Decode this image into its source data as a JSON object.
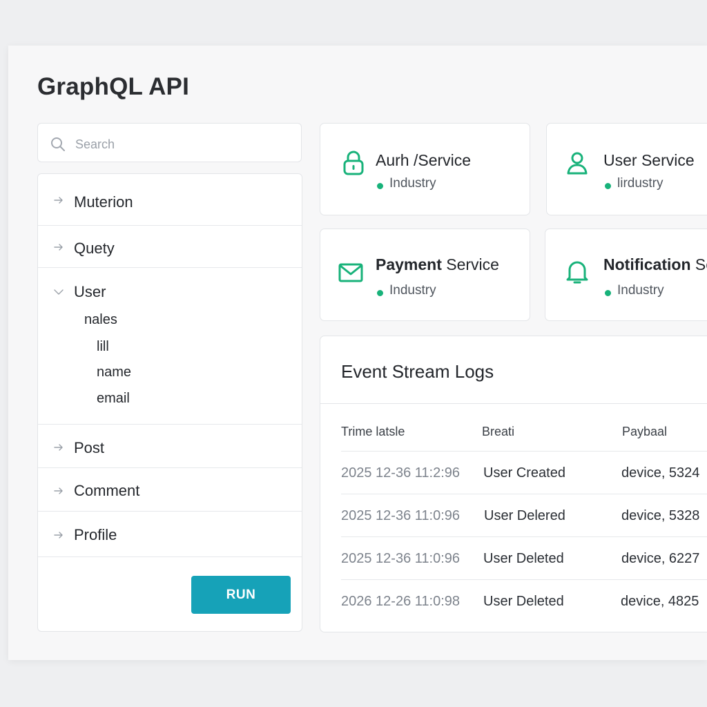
{
  "page": {
    "title": "GraphQL API"
  },
  "search": {
    "placeholder": "Search"
  },
  "tree": {
    "items": [
      {
        "label": "Muterion"
      },
      {
        "label": "Quety"
      },
      {
        "label": "User",
        "expanded": true
      },
      {
        "label": "Post"
      },
      {
        "label": "Comment"
      },
      {
        "label": "Profile"
      }
    ],
    "user_children": {
      "group": "nales",
      "fields": [
        "lill",
        "name",
        "email"
      ]
    },
    "run_label": "RUN"
  },
  "services": [
    {
      "name_bold": "",
      "name_rest": "Aurh /Service",
      "tag": "Industry",
      "icon": "lock-icon"
    },
    {
      "name_bold": "",
      "name_rest": "User Service",
      "tag": "lirdustry",
      "icon": "user-icon"
    },
    {
      "name_bold": "Payment",
      "name_rest": " Service",
      "tag": "Industry",
      "icon": "mail-icon"
    },
    {
      "name_bold": "Notification",
      "name_rest": " Service",
      "tag": "Industry",
      "icon": "bell-icon"
    }
  ],
  "logs": {
    "title": "Event Stream Logs",
    "columns": [
      "Trime latsle",
      "Breati",
      "Paybaal"
    ],
    "rows": [
      {
        "time": "2025 12-36 11:2:96",
        "event": "User Created",
        "payload": "device, 5324"
      },
      {
        "time": "2025 12-36 11:0:96",
        "event": "User Delered",
        "payload": "device, 5328"
      },
      {
        "time": "2025 12-36 11:0:96",
        "event": "User Deleted",
        "payload": "device, 6227"
      },
      {
        "time": "2026 12-26 11:0:98",
        "event": "User Deleted",
        "payload": "device, 4825"
      }
    ]
  },
  "colors": {
    "accent": "#16a2b8",
    "icon_green": "#18b27a",
    "status_dot": "#18b27a"
  }
}
